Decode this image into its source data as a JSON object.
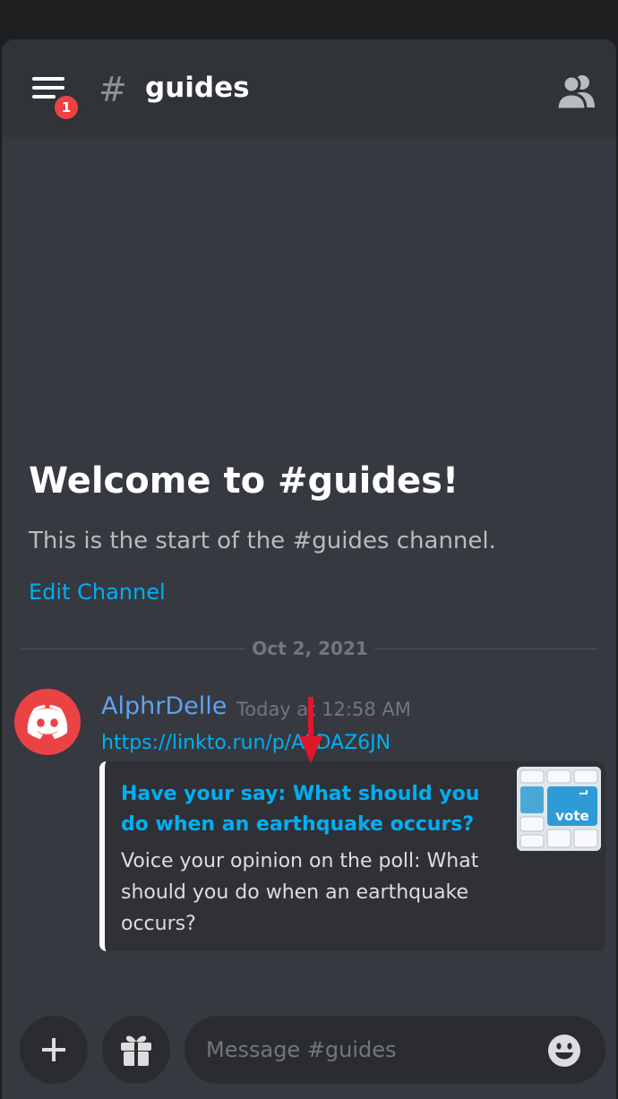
{
  "header": {
    "hash_symbol": "#",
    "channel_name": "guides",
    "notification_count": "1"
  },
  "welcome": {
    "title": "Welcome to #guides!",
    "subtitle": "This is the start of the #guides channel.",
    "edit_link": "Edit Channel"
  },
  "divider": {
    "date": "Oct 2, 2021"
  },
  "message": {
    "author": "AlphrDelle",
    "timestamp": "Today at 12:58 AM",
    "link": "https://linkto.run/p/ALDAZ6JN",
    "embed": {
      "title": "Have your say: What should you do when an earthquake occurs?",
      "description": "Voice your opinion on the poll:  What should you do when an earthquake occurs?",
      "thumbnail_text": "vote"
    }
  },
  "composer": {
    "placeholder": "Message #guides"
  },
  "icons": {
    "menu": "hamburger-menu-icon",
    "members": "members-icon",
    "avatar": "discord-logo-icon",
    "add": "plus-icon",
    "gift": "gift-icon",
    "emoji": "smiley-emoji-icon",
    "annotation": "red-arrow-icon"
  },
  "colors": {
    "background": "#36393f",
    "header": "#303338",
    "link": "#00aff4",
    "author": "#5ea2ef",
    "badge": "#ed4245",
    "annotation_arrow": "#e0162b"
  }
}
